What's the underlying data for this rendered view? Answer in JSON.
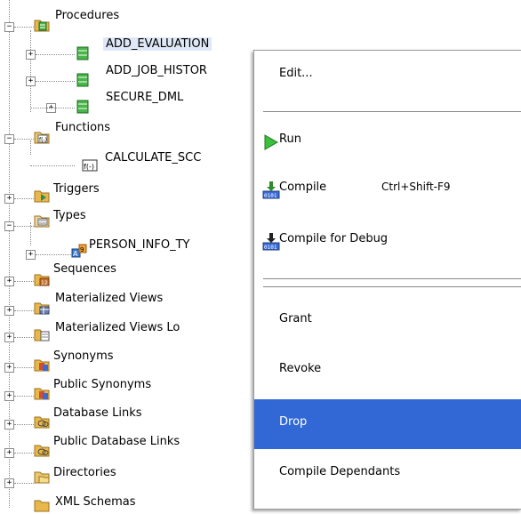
{
  "tree": {
    "items": [
      {
        "label": "Procedures",
        "icon": "folder-procedures-icon",
        "level": 0,
        "expander": "−"
      },
      {
        "label": "ADD_EVALUATION",
        "icon": "procedure-icon",
        "level": 1,
        "expander": "+"
      },
      {
        "label": "ADD_JOB_HISTOR",
        "icon": "procedure-icon",
        "level": 1,
        "expander": "+"
      },
      {
        "label": "SECURE_DML",
        "icon": "procedure-icon",
        "level": 1,
        "expander": "+"
      },
      {
        "label": "Functions",
        "icon": "folder-functions-icon",
        "level": 0,
        "expander": "−"
      },
      {
        "label": "CALCULATE_SCC",
        "icon": "function-icon",
        "level": 1,
        "expander": ""
      },
      {
        "label": "Triggers",
        "icon": "folder-triggers-icon",
        "level": 0,
        "expander": "+"
      },
      {
        "label": "Types",
        "icon": "folder-types-icon",
        "level": 0,
        "expander": "−"
      },
      {
        "label": "PERSON_INFO_TY",
        "icon": "type-icon",
        "level": 1,
        "expander": "+"
      },
      {
        "label": "Sequences",
        "icon": "folder-sequences-icon",
        "level": 0,
        "expander": "+"
      },
      {
        "label": "Materialized Views",
        "icon": "folder-materialized-views-icon",
        "level": 0,
        "expander": "+"
      },
      {
        "label": "Materialized Views Lo",
        "icon": "folder-mview-logs-icon",
        "level": 0,
        "expander": "+"
      },
      {
        "label": "Synonyms",
        "icon": "folder-synonyms-icon",
        "level": 0,
        "expander": "+"
      },
      {
        "label": "Public Synonyms",
        "icon": "folder-public-synonyms-icon",
        "level": 0,
        "expander": "+"
      },
      {
        "label": "Database Links",
        "icon": "folder-database-links-icon",
        "level": 0,
        "expander": "+"
      },
      {
        "label": "Public Database Links",
        "icon": "folder-public-database-links-icon",
        "level": 0,
        "expander": "+"
      },
      {
        "label": "Directories",
        "icon": "folder-directories-icon",
        "level": 0,
        "expander": "+"
      },
      {
        "label": "XML Schemas",
        "icon": "folder-xml-schemas-icon",
        "level": 0,
        "expander": ""
      }
    ]
  },
  "context_menu": {
    "items": [
      {
        "label": "Edit...",
        "accelerator": "",
        "icon": ""
      },
      {
        "label": "Run",
        "accelerator": "",
        "icon": "run-icon"
      },
      {
        "label": "Compile",
        "accelerator": "Ctrl+Shift-F9",
        "icon": "compile-icon"
      },
      {
        "label": "Compile for Debug",
        "accelerator": "",
        "icon": "compile-debug-icon"
      },
      {
        "label": "Grant",
        "accelerator": "",
        "icon": ""
      },
      {
        "label": "Revoke",
        "accelerator": "",
        "icon": ""
      },
      {
        "label": "Drop",
        "accelerator": "",
        "icon": ""
      },
      {
        "label": "Compile Dependants",
        "accelerator": "",
        "icon": ""
      }
    ],
    "highlighted": "Drop",
    "highlight_color": "#3168d5"
  }
}
